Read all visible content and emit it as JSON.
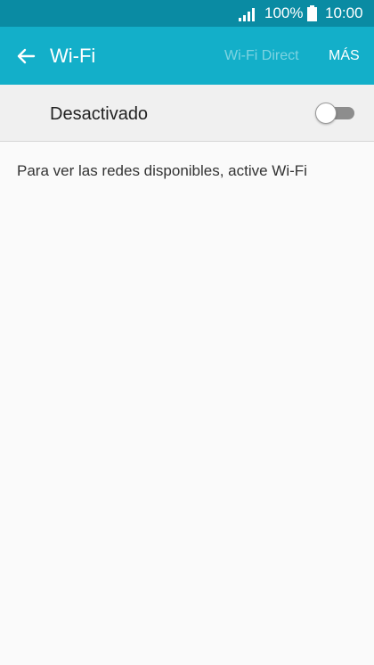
{
  "status_bar": {
    "battery": "100%",
    "time": "10:00",
    "signal_icon": "signal-bars-icon",
    "battery_icon": "battery-full-icon"
  },
  "app_bar": {
    "back_icon": "arrow-left-icon",
    "title": "Wi-Fi",
    "wifi_direct_label": "Wi-Fi Direct",
    "more_label": "MÁS"
  },
  "wifi_toggle": {
    "label": "Desactivado",
    "state": "off"
  },
  "info_message": "Para ver las redes disponibles, active Wi-Fi",
  "colors": {
    "status_bar": "#0a8ba3",
    "app_bar": "#13afc9",
    "background": "#fafafa",
    "toggle_row": "#f0f0f0"
  }
}
